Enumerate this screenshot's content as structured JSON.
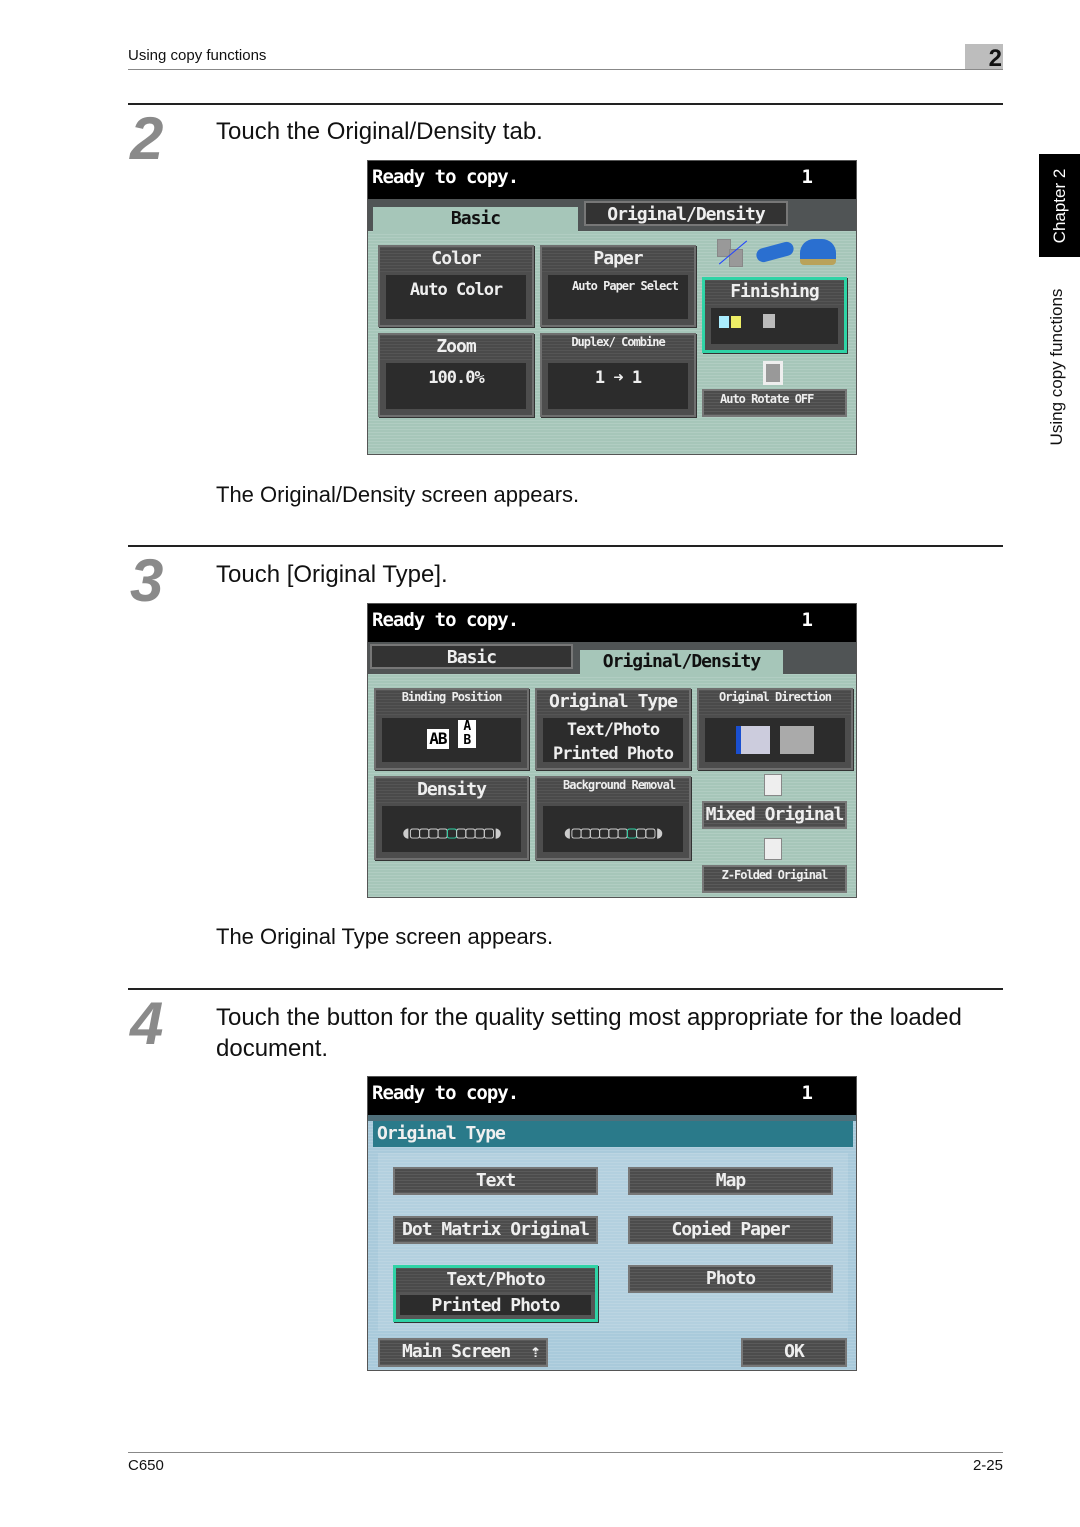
{
  "header": {
    "section": "Using copy functions",
    "chapter_number": "2"
  },
  "side": {
    "chapter_tab": "Chapter 2",
    "section": "Using copy functions"
  },
  "steps": [
    {
      "number": "2",
      "instruction": "Touch the Original/Density tab.",
      "result": "The Original/Density screen appears."
    },
    {
      "number": "3",
      "instruction": "Touch [Original Type].",
      "result": "The Original Type screen appears."
    },
    {
      "number": "4",
      "instruction": "Touch the button for the quality setting most appropriate for the loaded document."
    }
  ],
  "screen1": {
    "status": "Ready to copy.",
    "count": "1",
    "tabs": {
      "basic": "Basic",
      "original_density": "Original/Density",
      "active": "Basic"
    },
    "color": {
      "label": "Color",
      "value": "Auto Color"
    },
    "paper": {
      "label": "Paper",
      "value": "Auto Paper Select"
    },
    "zoom": {
      "label": "Zoom",
      "value": "100.0%"
    },
    "duplex": {
      "label": "Duplex/ Combine",
      "value": "1 ➜ 1"
    },
    "finishing": {
      "label": "Finishing"
    },
    "auto_rotate": {
      "label": "Auto Rotate OFF"
    }
  },
  "screen2": {
    "status": "Ready to copy.",
    "count": "1",
    "tabs": {
      "basic": "Basic",
      "original_density": "Original/Density",
      "active": "Original/Density"
    },
    "binding": {
      "label": "Binding Position"
    },
    "original_type": {
      "label": "Original Type",
      "value1": "Text/Photo",
      "value2": "Printed Photo"
    },
    "original_direction": {
      "label": "Original Direction"
    },
    "density": {
      "label": "Density",
      "level": "5 of 9"
    },
    "background": {
      "label": "Background Removal",
      "level": "7 of 9"
    },
    "mixed": "Mixed Original",
    "zfolded": "Z-Folded Original"
  },
  "screen3": {
    "status": "Ready to copy.",
    "count": "1",
    "title": "Original Type",
    "options": {
      "text": "Text",
      "map": "Map",
      "dot_matrix": "Dot Matrix Original",
      "copied_paper": "Copied Paper",
      "text_photo": "Text/Photo",
      "printed_photo": "Printed Photo",
      "photo": "Photo"
    },
    "selected": "Text/Photo - Printed Photo",
    "main_screen": "Main Screen",
    "ok": "OK"
  },
  "footer": {
    "model": "C650",
    "page": "2-25"
  },
  "colors": {
    "screen_green": "#a6c6b9",
    "screen_blue": "#a9cadb",
    "title_teal": "#2a7a8a",
    "selected_border": "#2fd3a6"
  }
}
